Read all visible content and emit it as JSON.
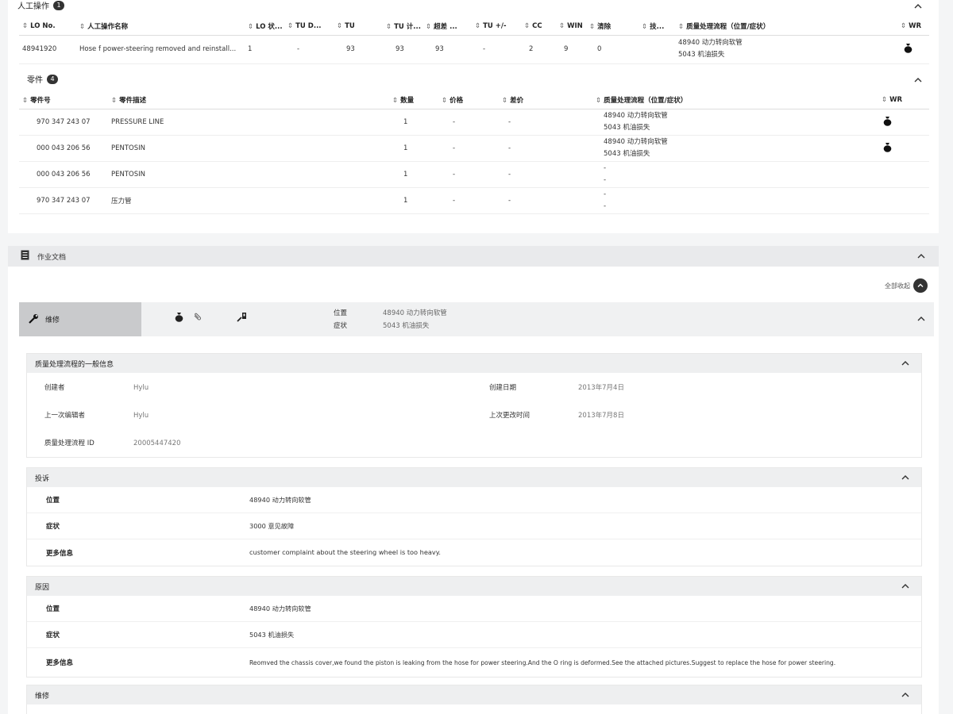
{
  "labor": {
    "title": "人工操作",
    "count": "1",
    "columns": [
      "LO No.",
      "人工操作名称",
      "LO 状...",
      "TU D...",
      "TU",
      "TU 计...",
      "超差 ...",
      "TU +/-",
      "CC",
      "WIN",
      "清除",
      "技...",
      "质量处理流程（位置/症状）",
      "WR"
    ],
    "row": {
      "lo_no": "48941920",
      "name": "Hose f power-steering removed and reinstall...",
      "status": "1",
      "tu_d": "-",
      "tu": "93",
      "tu_calc": "93",
      "over": "93",
      "tu_pm": "-",
      "cc": "2",
      "win": "9",
      "clear": "0",
      "tech": "",
      "qm_line1": "48940 动力转向软管",
      "qm_line2": "5043 机油损失"
    }
  },
  "parts": {
    "title": "零件",
    "count": "4",
    "columns": [
      "零件号",
      "零件描述",
      "数量",
      "价格",
      "差价",
      "质量处理流程（位置/症状）",
      "WR"
    ],
    "rows": [
      {
        "no": "970 347 243 07",
        "desc": "PRESSURE LINE",
        "qty": "1",
        "price": "-",
        "diff": "-",
        "qm1": "48940 动力转向软管",
        "qm2": "5043 机油损失"
      },
      {
        "no": "000 043 206 56",
        "desc": "PENTOSIN",
        "qty": "1",
        "price": "-",
        "diff": "-",
        "qm1": "48940 动力转向软管",
        "qm2": "5043 机油损失"
      },
      {
        "no": "000 043 206 56",
        "desc": "PENTOSIN",
        "qty": "1",
        "price": "-",
        "diff": "-",
        "qm1": "-",
        "qm2": "-"
      },
      {
        "no": "970 347 243 07",
        "desc": "压力管",
        "qty": "1",
        "price": "-",
        "diff": "-",
        "qm1": "-",
        "qm2": "-"
      }
    ]
  },
  "docs": {
    "title": "作业文档",
    "collapse_all": "全部收起"
  },
  "repair": {
    "tab_label": "维修",
    "position_label": "位置",
    "position_value": "48940 动力转向软管",
    "symptom_label": "症状",
    "symptom_value": "5043 机油损失"
  },
  "general": {
    "title": "质量处理流程的一般信息",
    "creator_label": "创建者",
    "creator_value": "Hylu",
    "created_label": "创建日期",
    "created_value": "2013年7月4日",
    "editor_label": "上一次编辑者",
    "editor_value": "Hylu",
    "modified_label": "上次更改时间",
    "modified_value": "2013年7月8日",
    "id_label": "质量处理流程 ID",
    "id_value": "20005447420"
  },
  "complaint": {
    "title": "投诉",
    "position_label": "位置",
    "position_value": "48940 动力转向软管",
    "symptom_label": "症状",
    "symptom_value": "3000 意见故障",
    "more_label": "更多信息",
    "more_value": "customer complaint about the steering wheel is too heavy."
  },
  "cause": {
    "title": "原因",
    "position_label": "位置",
    "position_value": "48940 动力转向软管",
    "symptom_label": "症状",
    "symptom_value": "5043 机油损失",
    "more_label": "更多信息",
    "more_value": "Reomved the chassis cover,we found the piston is leaking from the hose for power steering.And the O ring is deformed.See the attached pictures.Suggest to replace the hose for power steering."
  },
  "repair_card": {
    "title": "维修"
  }
}
